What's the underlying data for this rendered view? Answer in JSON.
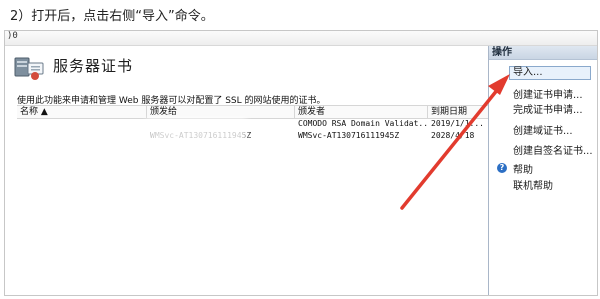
{
  "instruction": "2）打开后，点击右侧“导入”命令。",
  "window": {
    "top_glyph": ")0"
  },
  "header": {
    "title": "服务器证书"
  },
  "description": "使用此功能来申请和管理 Web 服务器可以对配置了 SSL 的网站使用的证书。",
  "table": {
    "columns": [
      "名称 ▲",
      "颁发给",
      "颁发者",
      "到期日期"
    ],
    "rows": [
      {
        "name": "",
        "issued_to": "",
        "issuer": "COMODO RSA Domain Validat...",
        "expires": "2019/1/1..."
      },
      {
        "name": "",
        "issued_to": "WMSvc-AT130716111945Z",
        "issuer": "WMSvc-AT130716111945Z",
        "expires": "2028/4/18"
      }
    ]
  },
  "actions": {
    "title": "操作",
    "items": [
      "导入...",
      "创建证书申请...",
      "完成证书申请...",
      "创建域证书...",
      "创建自签名证书..."
    ],
    "help": "帮助",
    "online_help": "联机帮助"
  },
  "colors": {
    "arrow": "#e23b2e",
    "accent": "#2c6fc4"
  }
}
